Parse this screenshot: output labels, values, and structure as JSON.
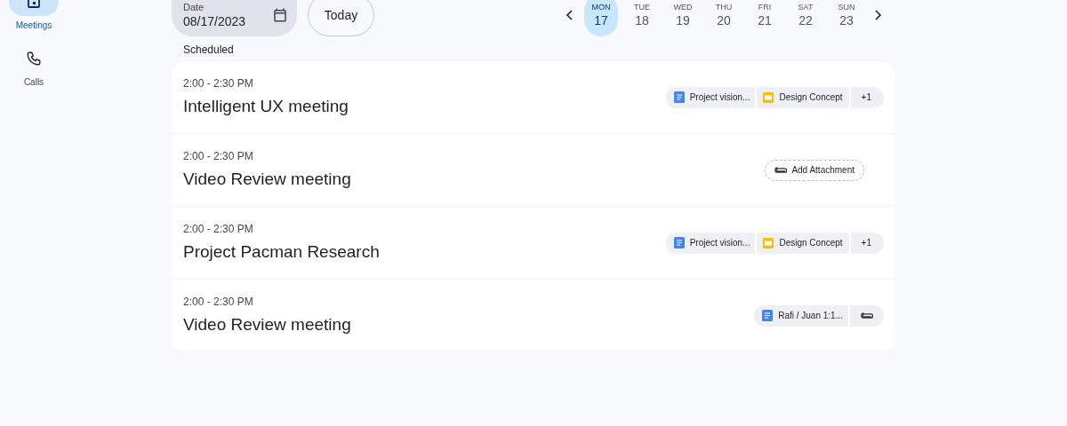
{
  "nav": [
    {
      "label": "Meetings",
      "selected": true
    },
    {
      "label": "Calls",
      "selected": false
    }
  ],
  "date_field": {
    "label": "Date",
    "value": "08/17/2023"
  },
  "today_button": "Today",
  "days": [
    {
      "weekday": "MON",
      "day": "17",
      "selected": true
    },
    {
      "weekday": "TUE",
      "day": "18",
      "selected": false
    },
    {
      "weekday": "WED",
      "day": "19",
      "selected": false
    },
    {
      "weekday": "THU",
      "day": "20",
      "selected": false
    },
    {
      "weekday": "FRI",
      "day": "21",
      "selected": false
    },
    {
      "weekday": "SAT",
      "day": "22",
      "selected": false
    },
    {
      "weekday": "SUN",
      "day": "23",
      "selected": false
    }
  ],
  "section_title": "Scheduled",
  "meetings": [
    {
      "time": "2:00 - 2:30 PM",
      "title": "Intelligent UX meeting",
      "attachments": [
        {
          "kind": "doc",
          "label": "Project vision..."
        },
        {
          "kind": "slides",
          "label": "Design Concept"
        },
        {
          "kind": "more",
          "label": "+1"
        }
      ]
    },
    {
      "time": "2:00 - 2:30 PM",
      "title": "Video Review meeting",
      "attachments": [
        {
          "kind": "add",
          "label": "Add Attachment"
        }
      ]
    },
    {
      "time": "2:00 - 2:30 PM",
      "title": "Project Pacman Research",
      "attachments": [
        {
          "kind": "doc",
          "label": "Project vision..."
        },
        {
          "kind": "slides",
          "label": "Design Concept"
        },
        {
          "kind": "more",
          "label": "+1"
        }
      ]
    },
    {
      "time": "2:00 - 2:30 PM",
      "title": "Video Review meeting",
      "attachments": [
        {
          "kind": "doc",
          "label": "Rafi / Juan 1:1..."
        },
        {
          "kind": "attach"
        }
      ]
    }
  ]
}
